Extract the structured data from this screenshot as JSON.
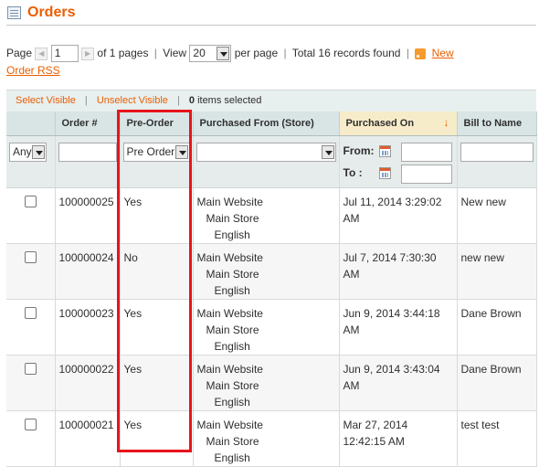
{
  "page": {
    "title": "Orders",
    "highlight_color": "#e8141b",
    "accent_color": "#eb5e00",
    "title_icon": "orders-icon"
  },
  "pager": {
    "page_label": "Page",
    "current_page": "1",
    "of_pages": "of 1 pages",
    "view_label": "View",
    "per_page_value": "20",
    "per_page_label": "per page",
    "total_text": "Total 16 records found",
    "rss_link_part1": "New",
    "rss_link_part2": "Order RSS",
    "rss_icon": "rss-icon"
  },
  "massaction": {
    "select_visible": "Select Visible",
    "unselect_visible": "Unselect Visible",
    "selected_count": "0",
    "selected_label": "items selected"
  },
  "columns": {
    "order_num": "Order #",
    "pre_order": "Pre-Order",
    "purchased_from": "Purchased From (Store)",
    "purchased_on": "Purchased On",
    "bill_to_name": "Bill to Name"
  },
  "filters": {
    "massaction_select": "Any",
    "pre_order_select": "Pre Order",
    "from_label": "From:",
    "to_label": "To :"
  },
  "rows": [
    {
      "order_num": "100000025",
      "pre_order": "Yes",
      "store": [
        "Main Website",
        "Main Store",
        "English"
      ],
      "date1": "Jul 11, 2014 3:29:02",
      "date2": "AM",
      "bill_to": "New new"
    },
    {
      "order_num": "100000024",
      "pre_order": "No",
      "store": [
        "Main Website",
        "Main Store",
        "English"
      ],
      "date1": "Jul 7, 2014 7:30:30",
      "date2": "AM",
      "bill_to": "new new"
    },
    {
      "order_num": "100000023",
      "pre_order": "Yes",
      "store": [
        "Main Website",
        "Main Store",
        "English"
      ],
      "date1": "Jun 9, 2014 3:44:18",
      "date2": "AM",
      "bill_to": "Dane Brown"
    },
    {
      "order_num": "100000022",
      "pre_order": "Yes",
      "store": [
        "Main Website",
        "Main Store",
        "English"
      ],
      "date1": "Jun 9, 2014 3:43:04",
      "date2": "AM",
      "bill_to": "Dane Brown"
    },
    {
      "order_num": "100000021",
      "pre_order": "Yes",
      "store": [
        "Main Website",
        "Main Store",
        "English"
      ],
      "date1": "Mar 27, 2014",
      "date2": "12:42:15 AM",
      "bill_to": "test test"
    }
  ]
}
